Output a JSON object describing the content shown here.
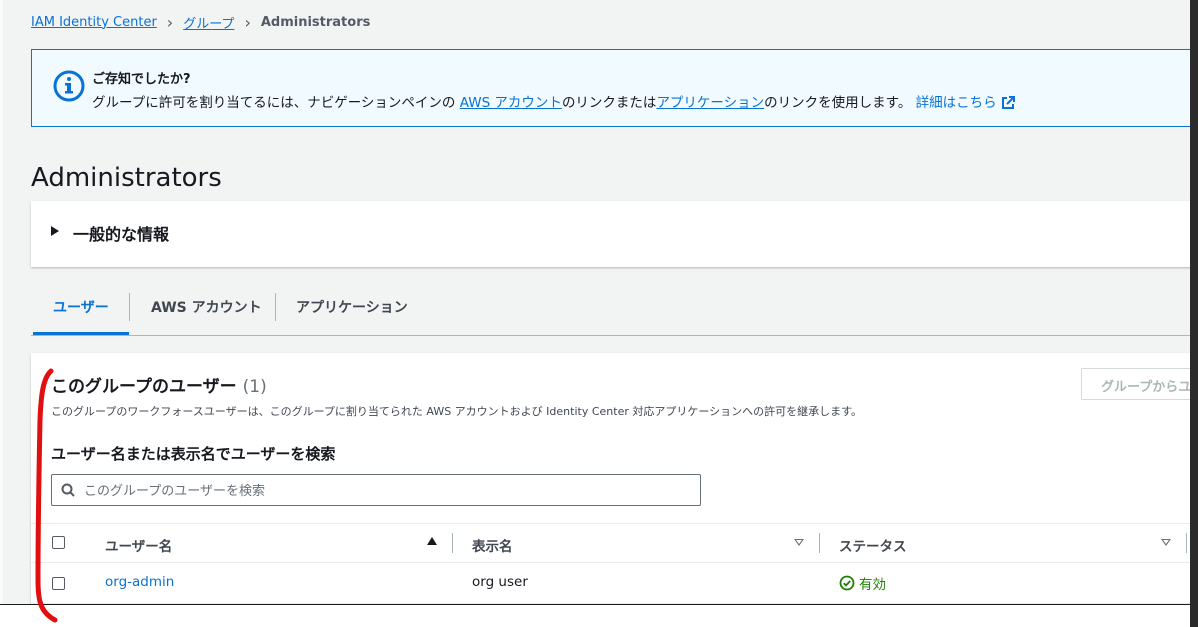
{
  "breadcrumb": {
    "items": [
      "IAM Identity Center",
      "グループ"
    ],
    "current": "Administrators",
    "separator": "›"
  },
  "alert": {
    "title": "ご存知でしたか?",
    "text_before": "グループに許可を割り当てるには、ナビゲーションペインの ",
    "link_aws": "AWS アカウント",
    "text_middle": "のリンクまたは",
    "link_apps": "アプリケーション",
    "text_after": "のリンクを使用します。",
    "learn_more": "詳細はこちら"
  },
  "page": {
    "title": "Administrators"
  },
  "general_info": {
    "label": "一般的な情報"
  },
  "tabs": [
    {
      "label": "ユーザー",
      "active": true
    },
    {
      "label": "AWS アカウント",
      "active": false
    },
    {
      "label": "アプリケーション",
      "active": false
    }
  ],
  "users_panel": {
    "title": "このグループのユーザー",
    "count": "(1)",
    "description": "このグループのワークフォースユーザーは、このグループに割り当てられた AWS アカウントおよび Identity Center 対応アプリケーションへの許可を継承します。",
    "remove_button": "グループからユ",
    "search_label": "ユーザー名または表示名でユーザーを検索",
    "search_placeholder": "このグループのユーザーを検索",
    "columns": [
      "ユーザー名",
      "表示名",
      "ステータス"
    ],
    "rows": [
      {
        "username": "org-admin",
        "display_name": "org user",
        "status": "有効"
      }
    ]
  },
  "colors": {
    "link": "#0972d3",
    "alert_bg": "#f1faff",
    "status_ok": "#1d8102",
    "annotation": "#e01010"
  }
}
